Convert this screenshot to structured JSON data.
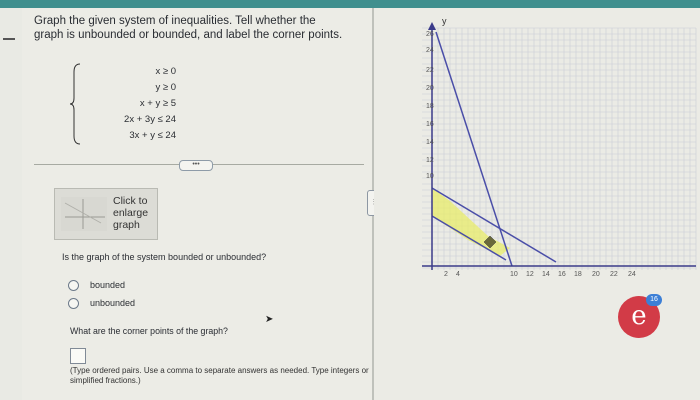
{
  "question": {
    "text": "Graph the given system of inequalities. Tell whether the graph is unbounded or bounded, and label the corner points."
  },
  "system": {
    "inequalities": [
      "x ≥ 0",
      "y ≥ 0",
      "x +  y ≥  5",
      "2x + 3y ≤ 24",
      "3x +  y ≤ 24"
    ]
  },
  "expand_label": "•••",
  "thumbnail": {
    "label": "Click to enlarge graph"
  },
  "bounded_question": "Is the graph of the system bounded or unbounded?",
  "options": [
    "bounded",
    "unbounded"
  ],
  "corner_question": "What are the corner points of the graph?",
  "answer_hint": "(Type ordered pairs. Use a comma to separate answers as needed. Type integers or simplified fractions.)",
  "graph": {
    "y_axis_label": "y",
    "y_ticks": [
      "26",
      "24",
      "22",
      "20",
      "18",
      "16",
      "14",
      "12",
      "10"
    ],
    "x_ticks": [
      "10",
      "12",
      "14",
      "16",
      "18",
      "20",
      "22",
      "24"
    ],
    "small_ticks": [
      "2",
      "4"
    ],
    "region_color": "#e8ec6a"
  },
  "badge": {
    "letter": "e",
    "count": "16"
  }
}
